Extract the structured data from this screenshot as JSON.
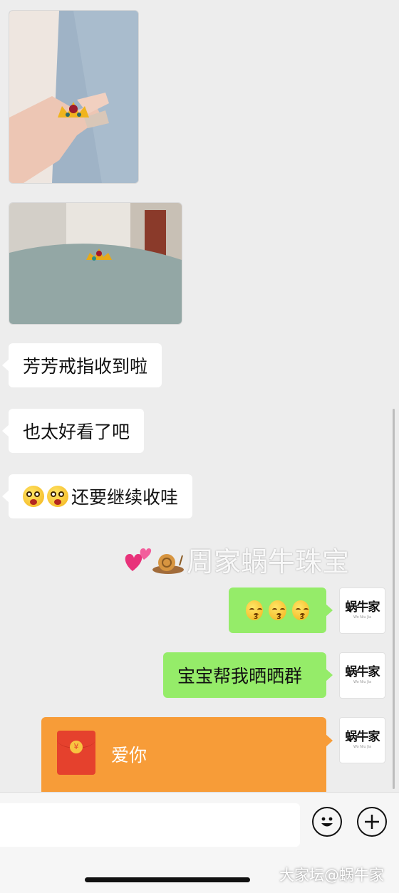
{
  "messages": {
    "incoming_1": "芳芳戒指收到啦",
    "incoming_2": "也太好看了吧",
    "incoming_3": "还要继续收哇",
    "outgoing_1": "宝宝帮我晒晒群",
    "red_packet_label": "爱你"
  },
  "avatar": {
    "logo": "蜗牛家",
    "sub": "Wo Niu Jia"
  },
  "watermark": "周家蜗牛珠宝",
  "corner_watermark": "大家坛@蜗牛家",
  "icons": {
    "emoji": "emoji-face-icon",
    "add": "plus-circle-icon",
    "red_packet": "red-packet-icon"
  },
  "colors": {
    "background": "#ededed",
    "outgoing_bubble": "#95ec69",
    "red_packet": "#f79c38"
  }
}
